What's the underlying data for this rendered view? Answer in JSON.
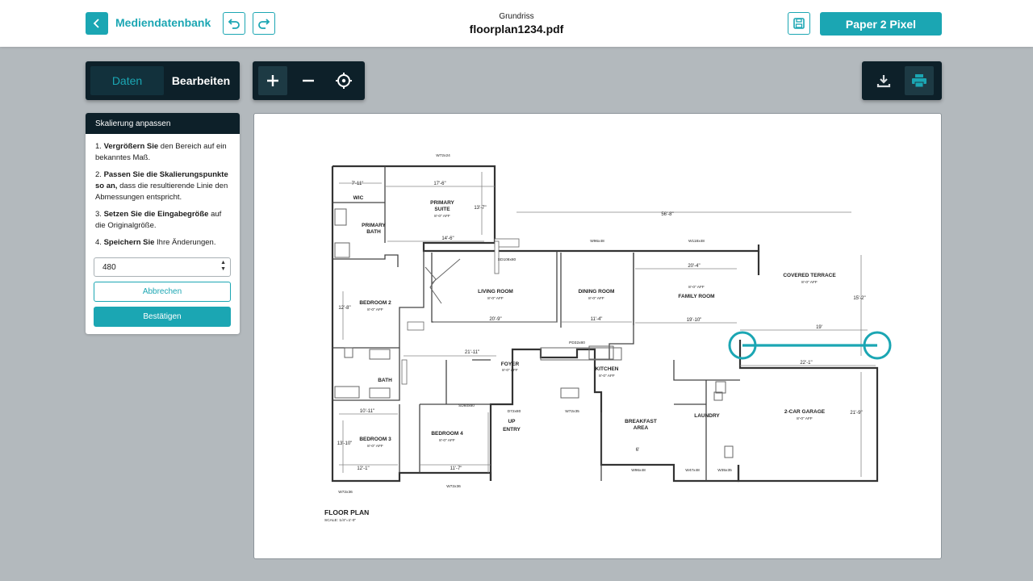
{
  "header": {
    "back_label": "Mediendatenbank",
    "doc_caption": "Grundriss",
    "doc_name": "floorplan1234.pdf",
    "brand_button": "Paper 2 Pixel"
  },
  "toolbar": {
    "tabs": [
      {
        "label": "Daten",
        "active": true
      },
      {
        "label": "Bearbeiten",
        "active": false
      }
    ]
  },
  "panel": {
    "title": "Skalierung anpassen",
    "steps": [
      {
        "bold": "Vergrößern Sie",
        "rest": " den Bereich auf ein bekanntes Maß."
      },
      {
        "bold": "Passen Sie die Skalierungspunkte so an,",
        "rest": " dass die resultierende Linie den Abmessungen entspricht."
      },
      {
        "bold": "Setzen Sie die Eingabegröße",
        "rest": " auf die Originalgröße."
      },
      {
        "bold": "Speichern Sie",
        "rest": " Ihre Änderungen."
      }
    ],
    "input_value": "480",
    "cancel_label": "Abbrechen",
    "confirm_label": "Bestätigen"
  },
  "floorplan": {
    "rooms": {
      "wic": "WIC",
      "primary_bath_1": "PRIMARY",
      "primary_bath_2": "BATH",
      "primary_suite_1": "PRIMARY",
      "primary_suite_2": "SUITE",
      "living": "LIVING ROOM",
      "dining": "DINING ROOM",
      "family": "FAMILY ROOM",
      "terrace": "COVERED TERRACE",
      "bedroom2": "BEDROOM 2",
      "bath": "BATH",
      "foyer": "FOYER",
      "kitchen": "KITCHEN",
      "garage": "2-CAR GARAGE",
      "laundry": "LAUNDRY",
      "breakfast_1": "BREAKFAST",
      "breakfast_2": "AREA",
      "bedroom3": "BEDROOM 3",
      "bedroom4": "BEDROOM 4",
      "entry": "ENTRY",
      "up": "UP"
    },
    "dims": {
      "d1": "17'-6\"",
      "d2": "7'-11\"",
      "d3": "14'-6\"",
      "d4": "56'-8\"",
      "d5": "20'-9\"",
      "d6": "11'-4\"",
      "d7": "19'-10\"",
      "d8": "20'-4\"",
      "d9": "19'",
      "d10": "22'-1\"",
      "d11": "21'-11\"",
      "d12": "10'-11\"",
      "d13": "12'-1\"",
      "d14": "11'-7\"",
      "d15": "15'-2\"",
      "d16": "21'-9\"",
      "d17": "13'-7\"",
      "d18": "12'-8\"",
      "d19": "13'-10\"",
      "d20": "6'"
    },
    "aff": "8'-0\" AFF",
    "windows": {
      "w1": "W72x24",
      "w2": "W96x48",
      "w3": "W118x48",
      "w4": "SD108x80",
      "w5": "PD32x80",
      "w6": "W72x35",
      "w7": "D72x80",
      "w8": "W96x48",
      "w9": "W47x48",
      "w10": "W35x35",
      "w11": "W72x36",
      "w12": "SD60x80",
      "w13": "W72x36"
    },
    "title": "FLOOR PLAN",
    "scale": "SCALE: 1/4\"=1'-0\""
  },
  "colors": {
    "accent": "#1ba6b3",
    "dark": "#0d2029",
    "background": "#b3b9bd"
  }
}
